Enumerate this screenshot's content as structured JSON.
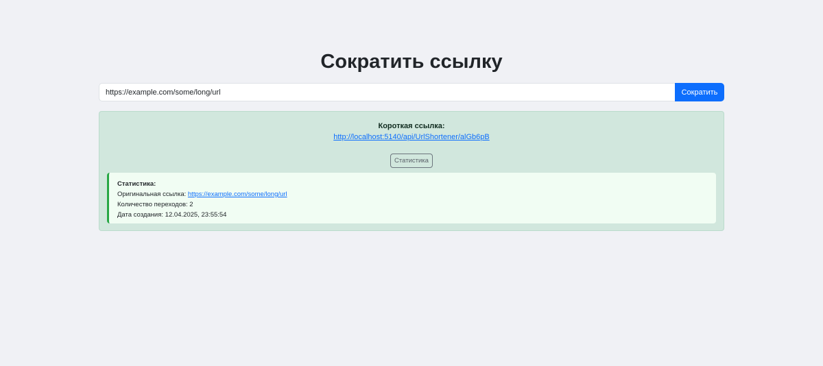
{
  "header": {
    "title": "Сократить ссылку"
  },
  "form": {
    "url_value": "https://example.com/some/long/url",
    "submit_label": "Сократить"
  },
  "result": {
    "short_label": "Короткая ссылка:",
    "short_url": "http://localhost:5140/api/UrlShortener/alGb6pB",
    "stats_button_label": "Статистика"
  },
  "stats": {
    "title": "Статистика:",
    "original_label": "Оригинальная ссылка: ",
    "original_url": "https://example.com/some/long/url",
    "clicks_line": "Количество переходов: 2",
    "created_line": "Дата создания: 12.04.2025, 23:55:54"
  },
  "colors": {
    "background": "#f0f1f5",
    "primary": "#0d6efd",
    "success_bg": "#d1e7dd",
    "stats_border": "#28a745"
  }
}
